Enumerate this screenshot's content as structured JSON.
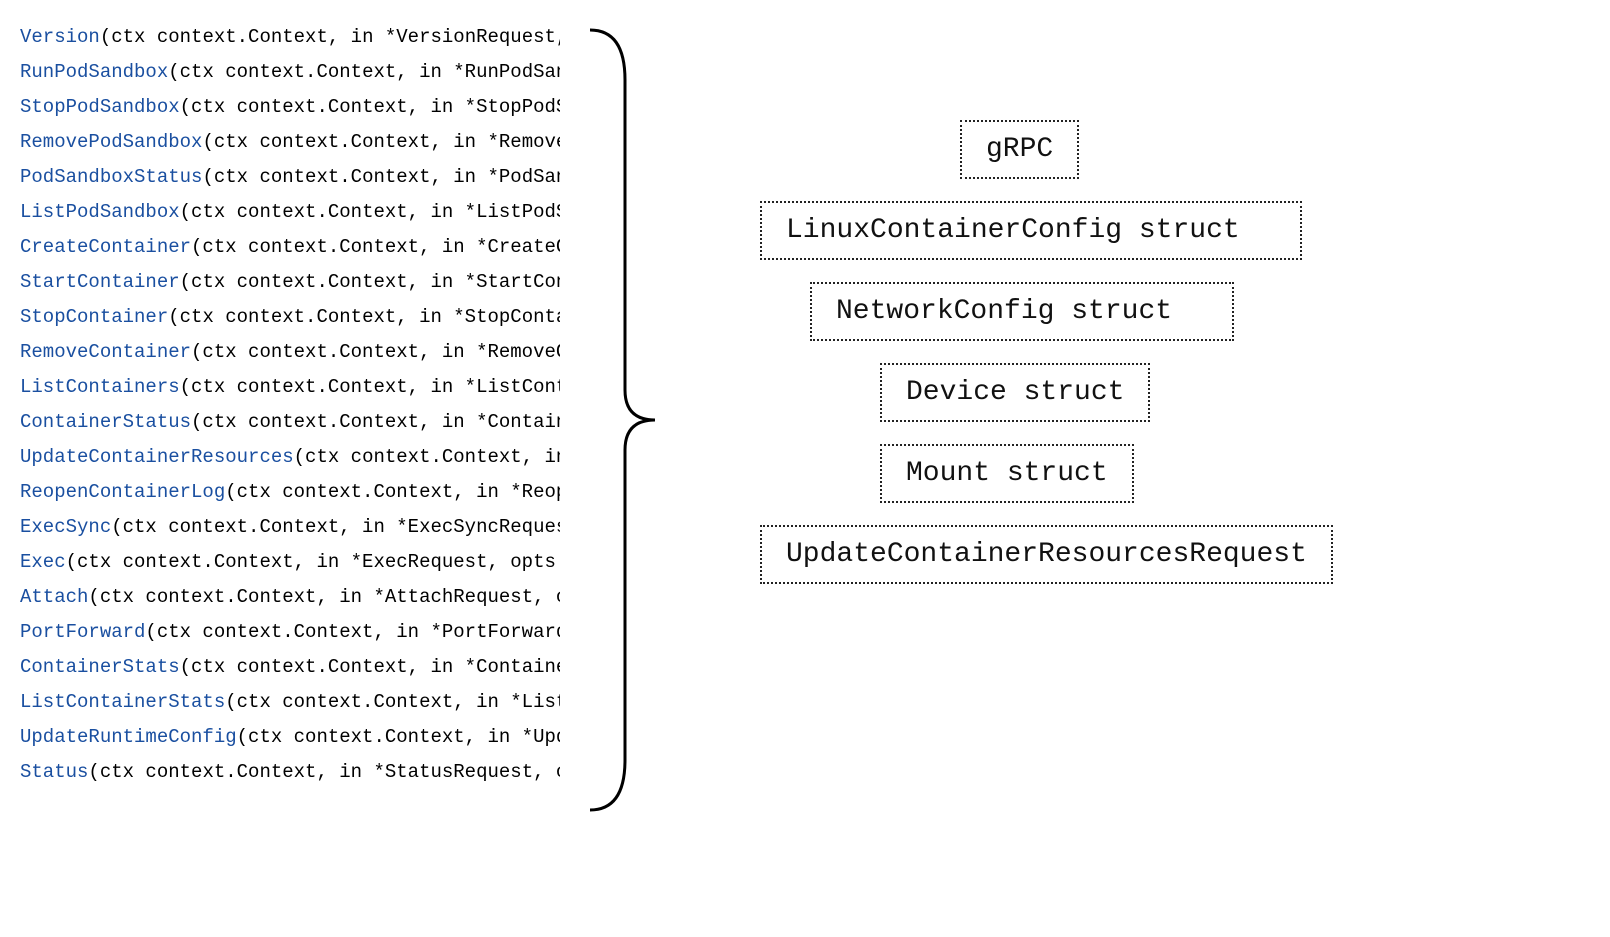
{
  "code_lines": [
    {
      "fn": "Version",
      "rest": "(ctx context.Context, in *VersionRequest, opts ..."
    },
    {
      "fn": "RunPodSandbox",
      "rest": "(ctx context.Context, in *RunPodSandboxRequest, ..."
    },
    {
      "fn": "StopPodSandbox",
      "rest": "(ctx context.Context, in *StopPodSandboxRequest, ..."
    },
    {
      "fn": "RemovePodSandbox",
      "rest": "(ctx context.Context, in *RemovePodSandboxRequest, ..."
    },
    {
      "fn": "PodSandboxStatus",
      "rest": "(ctx context.Context, in *PodSandboxStatusRequest, ..."
    },
    {
      "fn": "ListPodSandbox",
      "rest": "(ctx context.Context, in *ListPodSandboxRequest, ..."
    },
    {
      "fn": "CreateContainer",
      "rest": "(ctx context.Context, in *CreateContainerRequest, ..."
    },
    {
      "fn": "StartContainer",
      "rest": "(ctx context.Context, in *StartContainerRequest, ..."
    },
    {
      "fn": "StopContainer",
      "rest": "(ctx context.Context, in *StopContainerRequest, ..."
    },
    {
      "fn": "RemoveContainer",
      "rest": "(ctx context.Context, in *RemoveContainerRequest, ..."
    },
    {
      "fn": "ListContainers",
      "rest": "(ctx context.Context, in *ListContainersRequest, ..."
    },
    {
      "fn": "ContainerStatus",
      "rest": "(ctx context.Context, in *ContainerStatusRequest, ..."
    },
    {
      "fn": "UpdateContainerResources",
      "rest": "(ctx context.Context, in *Upda..."
    },
    {
      "fn": "ReopenContainerLog",
      "rest": "(ctx context.Context, in *ReopenContainerLog..."
    },
    {
      "fn": "ExecSync",
      "rest": "(ctx context.Context, in *ExecSyncRequest, opts ..."
    },
    {
      "fn": "Exec",
      "rest": "(ctx context.Context, in *ExecRequest, opts ...grpc"
    },
    {
      "fn": "Attach",
      "rest": "(ctx context.Context, in *AttachRequest, opts ..."
    },
    {
      "fn": "PortForward",
      "rest": "(ctx context.Context, in *PortForwardRequest, ..."
    },
    {
      "fn": "ContainerStats",
      "rest": "(ctx context.Context, in *ContainerStatsRequest..."
    },
    {
      "fn": "ListContainerStats",
      "rest": "(ctx context.Context, in *ListContainerSt..."
    },
    {
      "fn": "UpdateRuntimeConfig",
      "rest": "(ctx context.Context, in *UpdateRuntimeCo..."
    },
    {
      "fn": "Status",
      "rest": "(ctx context.Context, in *StatusRequest, opts ..."
    }
  ],
  "structs": {
    "grpc": "gRPC",
    "linux": "LinuxContainerConfig struct",
    "network": "NetworkConfig struct",
    "device": "Device struct",
    "mount": "Mount struct",
    "update": "UpdateContainerResourcesRequest"
  }
}
